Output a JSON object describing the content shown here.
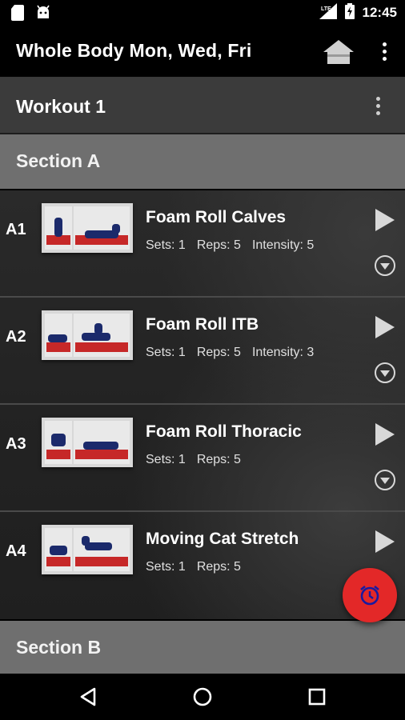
{
  "status_bar": {
    "time": "12:45",
    "left_icons": [
      "sd-card-icon",
      "android-icon"
    ],
    "right_icons": [
      "signal-icon",
      "battery-charging-icon"
    ]
  },
  "app_bar": {
    "title": "Whole Body Mon, Wed, Fri",
    "actions": [
      "home-icon",
      "overflow-menu-icon"
    ]
  },
  "workout": {
    "title": "Workout 1"
  },
  "sections": [
    {
      "title": "Section A"
    },
    {
      "title": "Section B"
    }
  ],
  "exercises": [
    {
      "code": "A1",
      "name": "Foam Roll Calves",
      "sets": "Sets: 1",
      "reps": "Reps: 5",
      "intensity": "Intensity: 5"
    },
    {
      "code": "A2",
      "name": "Foam Roll ITB",
      "sets": "Sets: 1",
      "reps": "Reps: 5",
      "intensity": "Intensity: 3"
    },
    {
      "code": "A3",
      "name": "Foam Roll Thoracic",
      "sets": "Sets: 1",
      "reps": "Reps: 5",
      "intensity": ""
    },
    {
      "code": "A4",
      "name": "Moving Cat Stretch",
      "sets": "Sets: 1",
      "reps": "Reps: 5",
      "intensity": ""
    }
  ],
  "fab": {
    "icon": "alarm-clock-icon",
    "color": "#e32828"
  },
  "nav_bar": {
    "buttons": [
      "back-icon",
      "home-circle-icon",
      "recents-icon"
    ]
  },
  "colors": {
    "section_header": "#6f6f6f",
    "workout_row": "#3b3b3b",
    "accent": "#e32828"
  }
}
